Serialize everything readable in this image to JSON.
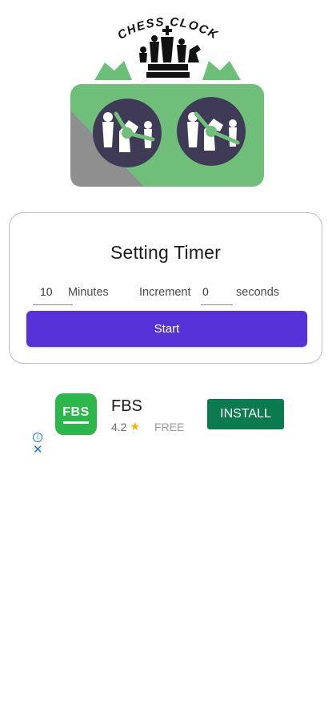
{
  "app": {
    "logo_text": "CHESS CLOCK"
  },
  "settings_card": {
    "title": "Setting Timer",
    "minutes_value": "10",
    "minutes_label": "Minutes",
    "increment_label": "Increment",
    "increment_value": "0",
    "seconds_label": "seconds",
    "start_label": "Start",
    "accent_color": "#5533d8"
  },
  "ad": {
    "icon_text": "FBS",
    "app_name": "FBS",
    "rating": "4.2",
    "price": "FREE",
    "install_label": "INSTALL",
    "install_color": "#0b7a4f",
    "icon_color": "#2bb74a",
    "info_icon": "info-icon",
    "close_icon": "close-icon"
  }
}
